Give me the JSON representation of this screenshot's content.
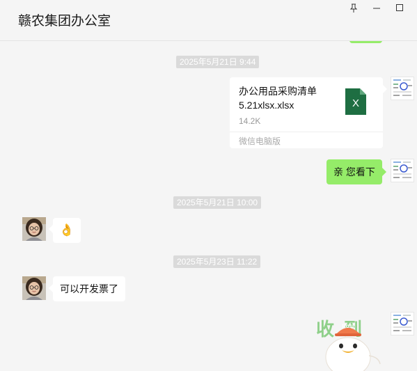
{
  "window": {
    "title": "赣农集团办公室",
    "pin_icon": "pin-icon",
    "minimize_icon": "minimize-icon",
    "maximize_icon": "maximize-icon"
  },
  "messages": {
    "ts1": "2025年5月21日 9:44",
    "file": {
      "name_line1": "办公用品采购清单",
      "name_line2": "5.21xlsx.xlsx",
      "size": "14.2K",
      "source": "微信电脑版",
      "icon_letter": "X",
      "icon_color": "#1e6e42"
    },
    "reply_text": "亲 您看下",
    "ts2": "2025年5月21日 10:00",
    "ok_emoji": "👌",
    "ts3": "2025年5月23日 11:22",
    "invoice_text": "可以开发票了",
    "sticker": {
      "chars": "收到",
      "badge": "Post",
      "chars_color": "#8fd08a",
      "badge_color": "#f07a4b"
    }
  },
  "colors": {
    "sent_bubble": "#95ec69",
    "received_bubble": "#ffffff",
    "background": "#f5f5f5",
    "timestamp_bg": "#dadada"
  }
}
